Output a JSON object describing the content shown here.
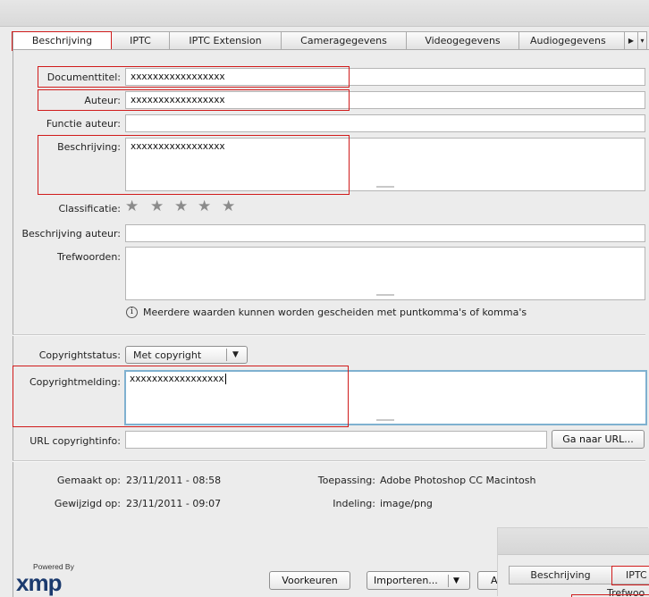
{
  "tabs": [
    {
      "label": "Beschrijving",
      "active": true
    },
    {
      "label": "IPTC"
    },
    {
      "label": "IPTC Extension"
    },
    {
      "label": "Cameragegevens"
    },
    {
      "label": "Videogegevens"
    },
    {
      "label": "Audiogegevens"
    }
  ],
  "form": {
    "documenttitel": {
      "label": "Documenttitel:",
      "value": "xxxxxxxxxxxxxxxxx"
    },
    "auteur": {
      "label": "Auteur:",
      "value": "xxxxxxxxxxxxxxxxx"
    },
    "functie_auteur": {
      "label": "Functie auteur:",
      "value": ""
    },
    "beschrijving": {
      "label": "Beschrijving:",
      "value": "xxxxxxxxxxxxxxxxx"
    },
    "classificatie": {
      "label": "Classificatie:",
      "rating": 0,
      "max": 5
    },
    "beschrijving_auteur": {
      "label": "Beschrijving auteur:",
      "value": ""
    },
    "trefwoorden": {
      "label": "Trefwoorden:",
      "value": ""
    },
    "hint": "Meerdere waarden kunnen worden gescheiden met puntkomma's of komma's"
  },
  "copyright": {
    "status_label": "Copyrightstatus:",
    "status_value": "Met copyright",
    "melding_label": "Copyrightmelding:",
    "melding_value": "xxxxxxxxxxxxxxxxx",
    "url_label": "URL copyrightinfo:",
    "url_value": "",
    "goto_button": "Ga naar URL..."
  },
  "meta": {
    "gemaakt_label": "Gemaakt op:",
    "gemaakt_value": "23/11/2011 - 08:58",
    "gewijzigd_label": "Gewijzigd op:",
    "gewijzigd_value": "23/11/2011 - 09:07",
    "toepassing_label": "Toepassing:",
    "toepassing_value": "Adobe Photoshop CC Macintosh",
    "indeling_label": "Indeling:",
    "indeling_value": "image/png"
  },
  "footer": {
    "powered_by": "Powered By",
    "logo": "xmp",
    "voorkeuren": "Voorkeuren",
    "importeren": "Importeren...",
    "cut_button": "A"
  },
  "inset": {
    "tab1": "Beschrijving",
    "tab2": "IPTC",
    "field_label": "Trefwoo"
  },
  "icons": {
    "info": "info-icon",
    "dropdown": "chevron-down-icon",
    "star": "star-icon",
    "more": "triangle-right-icon"
  },
  "colors": {
    "highlight": "#d01b1b",
    "focus_border": "#7fb1d0",
    "star": "#8b8b8b"
  }
}
